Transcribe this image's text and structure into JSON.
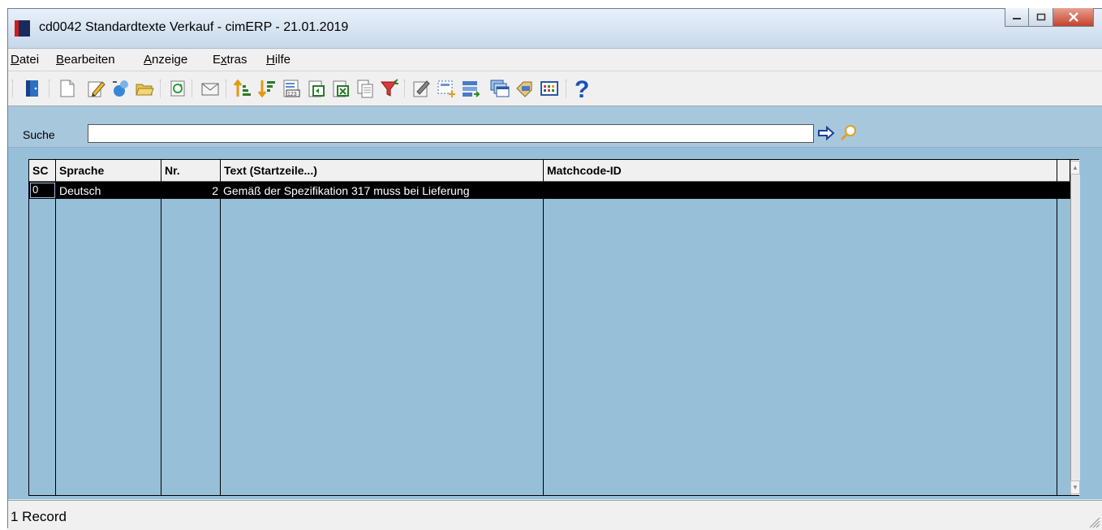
{
  "window": {
    "title": "cd0042 Standardtexte Verkauf - cimERP - 21.01.2019"
  },
  "menu": [
    {
      "pre": "",
      "u": "D",
      "post": "atei"
    },
    {
      "pre": "",
      "u": "B",
      "post": "earbeiten"
    },
    {
      "pre": "",
      "u": "A",
      "post": "nzeige"
    },
    {
      "pre": "E",
      "u": "x",
      "post": "tras"
    },
    {
      "pre": "",
      "u": "H",
      "post": "ilfe"
    }
  ],
  "toolbar_icons": [
    "exit-door-icon",
    "new-document-icon",
    "edit-pencil-icon",
    "copy-record-icon",
    "open-folder-icon",
    "refresh-icon",
    "mail-icon",
    "sort-ascending-icon",
    "sort-descending-icon",
    "number-list-icon",
    "import-icon",
    "excel-export-icon",
    "copy-pages-icon",
    "filter-icon",
    "properties-icon",
    "select-area-icon",
    "layout-icon",
    "windows-icon",
    "tag-label-icon",
    "grid-view-icon",
    "help-icon"
  ],
  "search": {
    "label": "Suche",
    "value": ""
  },
  "grid": {
    "columns": [
      "SC",
      "Sprache",
      "Nr.",
      "Text (Startzeile...)",
      "Matchcode-ID"
    ],
    "rows": [
      {
        "sc": "0",
        "sprache": "Deutsch",
        "nr": "2",
        "text": "Gemäß der Spezifikation 317 muss bei Lieferung",
        "matchcode": ""
      }
    ]
  },
  "status": {
    "text": "1 Record"
  }
}
